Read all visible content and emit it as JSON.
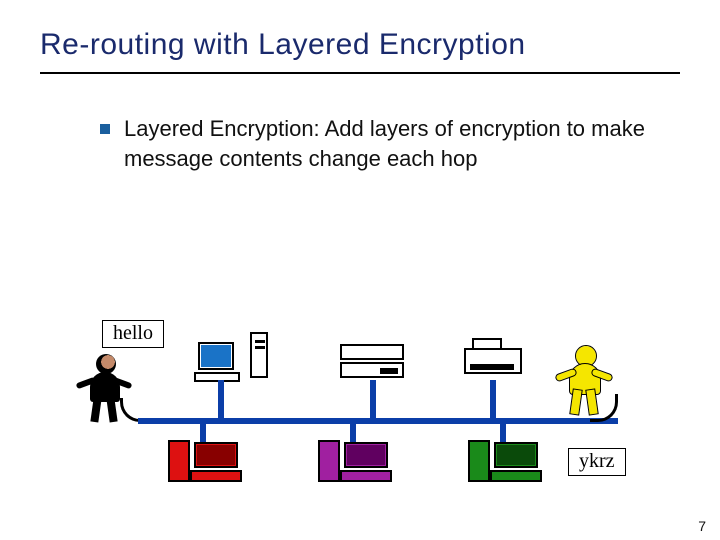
{
  "title": "Re-routing with Layered Encryption",
  "bullet": {
    "text": "Layered Encryption:  Add layers of encryption to make message contents change each hop"
  },
  "diagram": {
    "label_plain": "hello",
    "label_cipher": "ykrz",
    "sender": "sender-person",
    "receiver": "receiver-person",
    "top_devices": [
      "desktop-pc",
      "tower-pc",
      "rack-server",
      "printer"
    ],
    "router_colors": [
      "#d11",
      "#a020a0",
      "#1a8a1a"
    ]
  },
  "page_number": "7"
}
